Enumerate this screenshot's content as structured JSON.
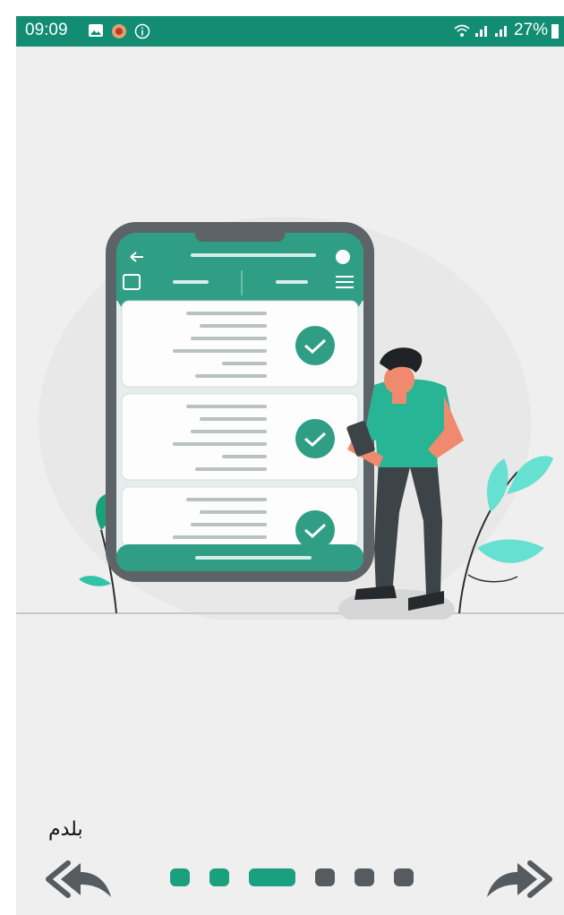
{
  "status_bar": {
    "time": "09:09",
    "battery": "27%",
    "icons": [
      "image-icon",
      "app-icon",
      "info-icon",
      "wifi-icon",
      "signal-icon",
      "signal-icon",
      "battery-icon"
    ]
  },
  "illustration": {
    "label": "onboarding-illustration-phone-and-person"
  },
  "onboarding": {
    "text": "بلدم",
    "page_count": 6,
    "active_page": 3
  },
  "nav": {
    "prev_icon": "double-arrow-back-icon",
    "next_icon": "double-arrow-forward-icon"
  },
  "colors": {
    "status_bar": "#128c73",
    "accent": "#1aa07e",
    "inactive_dot": "#555b5e",
    "background": "#efefef"
  }
}
